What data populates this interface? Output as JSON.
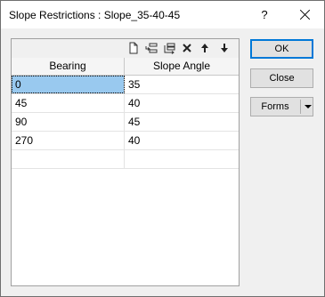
{
  "window": {
    "title": "Slope Restrictions : Slope_35-40-45",
    "help_label": "?"
  },
  "toolbar": {
    "icons": [
      "new-row-icon",
      "insert-row-icon",
      "append-row-icon",
      "delete-row-icon",
      "move-up-icon",
      "move-down-icon"
    ]
  },
  "grid": {
    "columns": [
      "Bearing",
      "Slope Angle"
    ],
    "rows": [
      [
        "0",
        "35"
      ],
      [
        "45",
        "40"
      ],
      [
        "90",
        "45"
      ],
      [
        "270",
        "40"
      ],
      [
        "",
        ""
      ]
    ],
    "selected_row": 0,
    "selected_col": 0
  },
  "buttons": {
    "ok": "OK",
    "close": "Close",
    "forms": "Forms"
  },
  "colors": {
    "selection": "#99c9ef",
    "default_button_border": "#0078d7"
  }
}
